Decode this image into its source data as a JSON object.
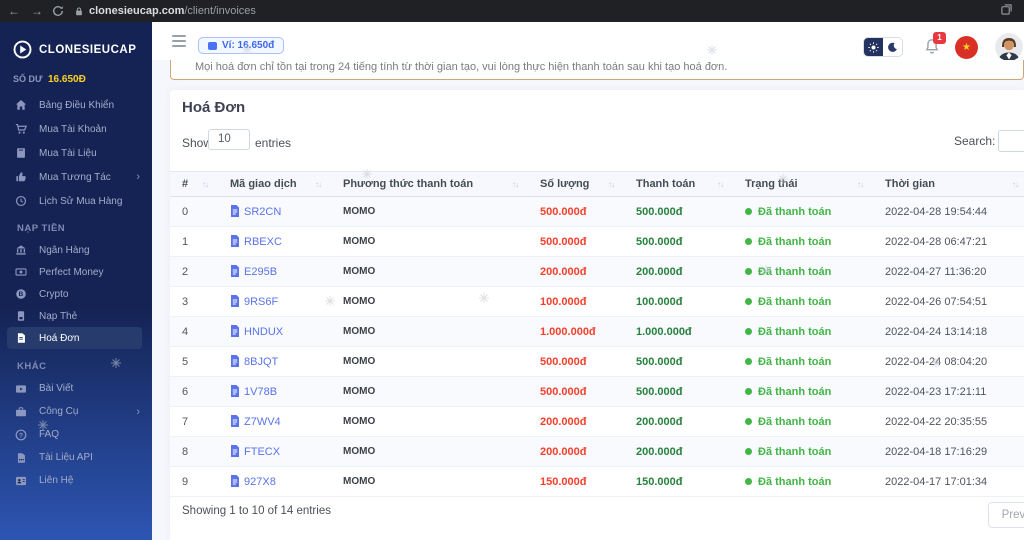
{
  "browser": {
    "url_domain": "clonesieucap.com",
    "url_path": "/client/invoices"
  },
  "sidebar": {
    "brand": "CLONESIEUCAP",
    "balance_label": "SỐ DƯ",
    "balance_value": "16.650Đ",
    "sections": [
      {
        "header": "",
        "items": [
          {
            "label": "Bảng Điều Khiển",
            "icon": "home"
          },
          {
            "label": "Mua Tài Khoản",
            "icon": "cart"
          },
          {
            "label": "Mua Tài Liệu",
            "icon": "book"
          },
          {
            "label": "Mua Tương Tác",
            "icon": "thumb",
            "chevron": true
          },
          {
            "label": "Lịch Sử Mua Hàng",
            "icon": "history"
          }
        ]
      },
      {
        "header": "NẠP TIỀN",
        "items": [
          {
            "label": "Ngân Hàng",
            "icon": "bank"
          },
          {
            "label": "Perfect Money",
            "icon": "money"
          },
          {
            "label": "Crypto",
            "icon": "crypto"
          },
          {
            "label": "Nạp Thẻ",
            "icon": "simcard"
          },
          {
            "label": "Hoá Đơn",
            "icon": "invoice",
            "active": true
          }
        ]
      },
      {
        "header": "KHÁC",
        "items": [
          {
            "label": "Bài Viết",
            "icon": "video"
          },
          {
            "label": "Công Cụ",
            "icon": "briefcase",
            "chevron": true
          },
          {
            "label": "FAQ",
            "icon": "question"
          },
          {
            "label": "Tài Liệu API",
            "icon": "fileapi"
          },
          {
            "label": "Liên Hệ",
            "icon": "contact"
          }
        ]
      }
    ]
  },
  "topbar": {
    "wallet_label": "Ví: 16.650đ",
    "notification_count": "1"
  },
  "alert": {
    "text": "Mọi hoá đơn chỉ tồn tại trong 24 tiếng tính từ thời gian tạo, vui lòng thực hiện thanh toán sau khi tạo hoá đơn."
  },
  "page": {
    "title": "Hoá Đơn",
    "show_label": "Show",
    "show_value": "10",
    "entries_label": "entries",
    "search_label": "Search:",
    "footer_text": "Showing 1 to 10 of 14 entries",
    "previous_label": "Previous"
  },
  "table": {
    "columns": [
      "#",
      "Mã giao dịch",
      "Phương thức thanh toán",
      "Số lượng",
      "Thanh toán",
      "Trạng thái",
      "Thời gian"
    ],
    "rows": [
      {
        "index": "0",
        "code": "SR2CN",
        "method": "MOMO",
        "amount": "500.000đ",
        "paid": "500.000đ",
        "status": "Đã thanh toán",
        "time": "2022-04-28 19:54:44"
      },
      {
        "index": "1",
        "code": "RBEXC",
        "method": "MOMO",
        "amount": "500.000đ",
        "paid": "500.000đ",
        "status": "Đã thanh toán",
        "time": "2022-04-28 06:47:21"
      },
      {
        "index": "2",
        "code": "E295B",
        "method": "MOMO",
        "amount": "200.000đ",
        "paid": "200.000đ",
        "status": "Đã thanh toán",
        "time": "2022-04-27 11:36:20"
      },
      {
        "index": "3",
        "code": "9RS6F",
        "method": "MOMO",
        "amount": "100.000đ",
        "paid": "100.000đ",
        "status": "Đã thanh toán",
        "time": "2022-04-26 07:54:51"
      },
      {
        "index": "4",
        "code": "HNDUX",
        "method": "MOMO",
        "amount": "1.000.000đ",
        "paid": "1.000.000đ",
        "status": "Đã thanh toán",
        "time": "2022-04-24 13:14:18"
      },
      {
        "index": "5",
        "code": "8BJQT",
        "method": "MOMO",
        "amount": "500.000đ",
        "paid": "500.000đ",
        "status": "Đã thanh toán",
        "time": "2022-04-24 08:04:20"
      },
      {
        "index": "6",
        "code": "1V78B",
        "method": "MOMO",
        "amount": "500.000đ",
        "paid": "500.000đ",
        "status": "Đã thanh toán",
        "time": "2022-04-23 17:21:11"
      },
      {
        "index": "7",
        "code": "Z7WV4",
        "method": "MOMO",
        "amount": "200.000đ",
        "paid": "200.000đ",
        "status": "Đã thanh toán",
        "time": "2022-04-22 20:35:55"
      },
      {
        "index": "8",
        "code": "FTECX",
        "method": "MOMO",
        "amount": "200.000đ",
        "paid": "200.000đ",
        "status": "Đã thanh toán",
        "time": "2022-04-18 17:16:29"
      },
      {
        "index": "9",
        "code": "927X8",
        "method": "MOMO",
        "amount": "150.000đ",
        "paid": "150.000đ",
        "status": "Đã thanh toán",
        "time": "2022-04-17 17:01:34"
      }
    ]
  },
  "colors": {
    "sidebar_top": "#142354",
    "sidebar_bottom": "#2d55b2",
    "accent_blue": "#5b73e8",
    "danger_red": "#f4402c",
    "paid_green": "#28813e",
    "status_green": "#41b546",
    "balance_yellow": "#ffd21f",
    "alert_border": "#cda675",
    "badge_red": "#ea3842"
  }
}
